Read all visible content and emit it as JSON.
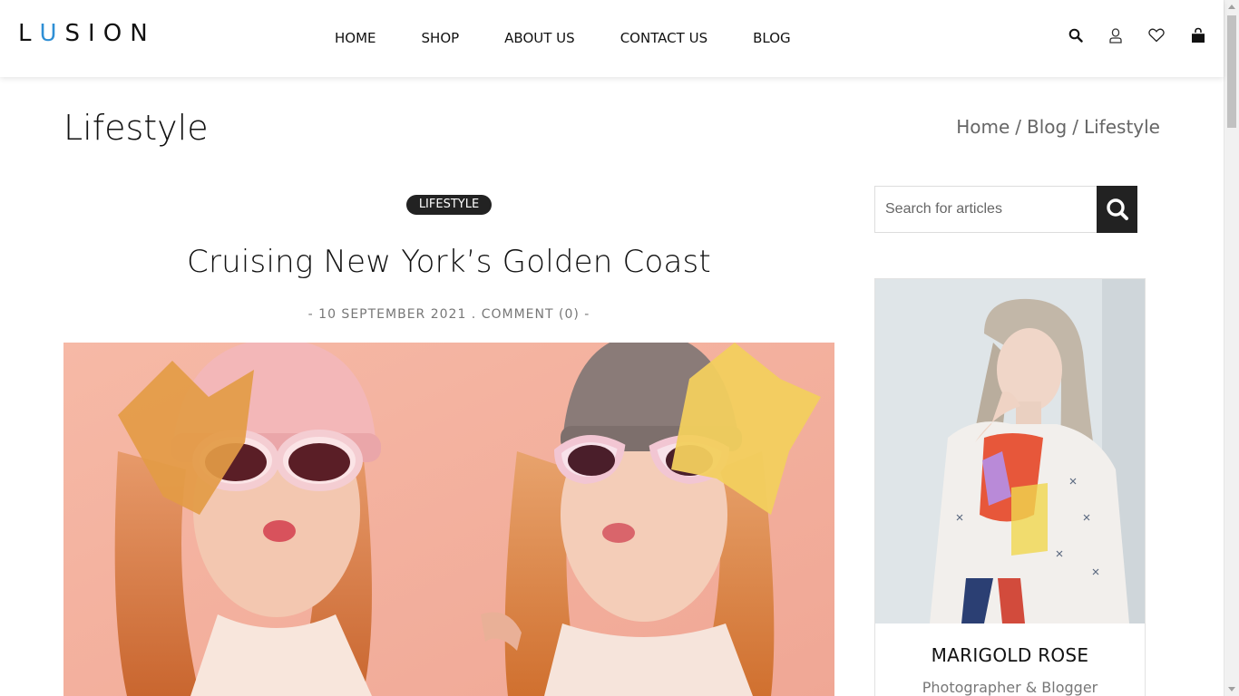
{
  "header": {
    "logo": {
      "letters": [
        "L",
        "U",
        "S",
        "I",
        "O",
        "N"
      ],
      "accent_index": 1,
      "accent_color": "#2f8fd5"
    },
    "nav": [
      "HOME",
      "SHOP",
      "ABOUT US",
      "CONTACT US",
      "BLOG"
    ],
    "icons": [
      "search-icon",
      "user-icon",
      "heart-icon",
      "shopping-bag-icon"
    ]
  },
  "page": {
    "title": "Lifestyle",
    "breadcrumb": {
      "home": "Home",
      "sep1": "/",
      "blog": "Blog",
      "sep2": "/",
      "current": "Lifestyle"
    }
  },
  "post": {
    "category": "LIFESTYLE",
    "title": "Cruising New York’s Golden Coast",
    "meta_prefix": "- ",
    "date": "10 SEPTEMBER 2021",
    "meta_sep": " . ",
    "comments": "COMMENT (0)",
    "meta_suffix": " -"
  },
  "sidebar": {
    "search": {
      "placeholder": "Search for articles",
      "value": ""
    },
    "author": {
      "name": "MARIGOLD ROSE",
      "role": "Photographer & Blogger"
    }
  },
  "colors": {
    "accent": "#2f8fd5",
    "dark": "#222222",
    "muted": "#777777"
  }
}
